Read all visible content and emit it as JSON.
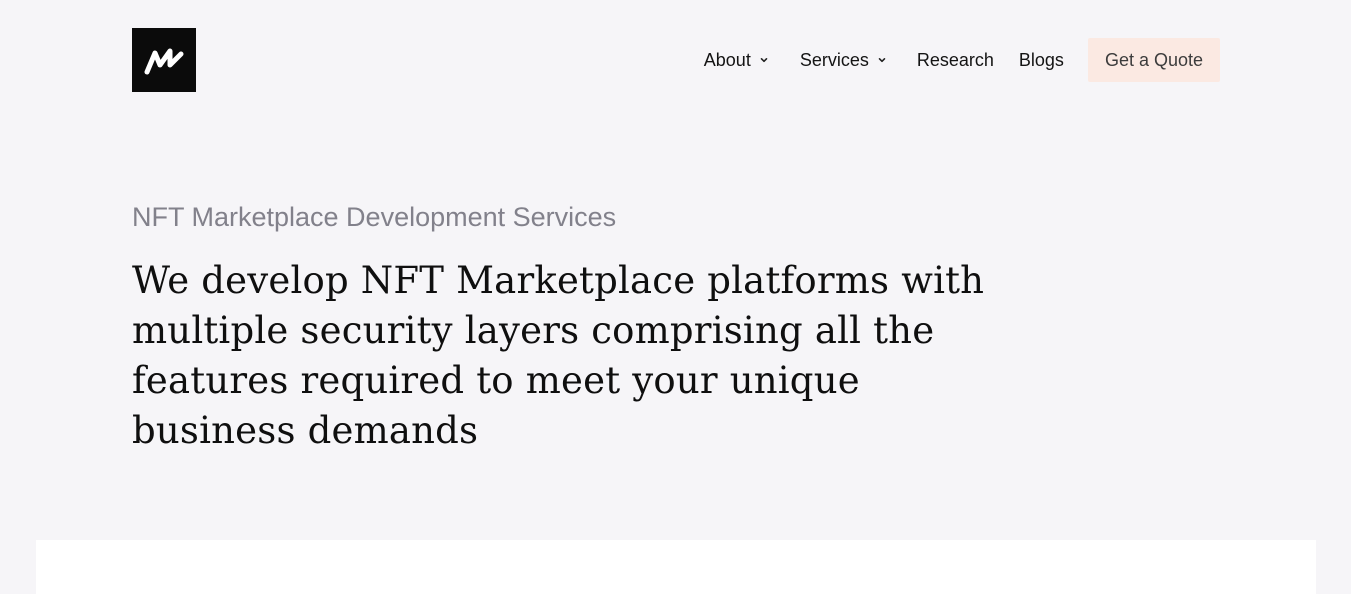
{
  "logo": {
    "icon": "w-logo-icon",
    "background": "#0b0b0b"
  },
  "nav": {
    "items": [
      {
        "label": "About",
        "has_dropdown": true
      },
      {
        "label": "Services",
        "has_dropdown": true
      },
      {
        "label": "Research",
        "has_dropdown": false
      },
      {
        "label": "Blogs",
        "has_dropdown": false
      }
    ],
    "cta_label": "Get a Quote",
    "cta_background": "#fbe9e2"
  },
  "hero": {
    "eyebrow": "NFT Marketplace Development Services",
    "headline": "We develop NFT Marketplace platforms with multiple security layers comprising all the features required to meet your unique business demands"
  },
  "colors": {
    "page_background": "#f6f5f8",
    "panel_background": "#ffffff",
    "eyebrow_text": "#82818b"
  }
}
